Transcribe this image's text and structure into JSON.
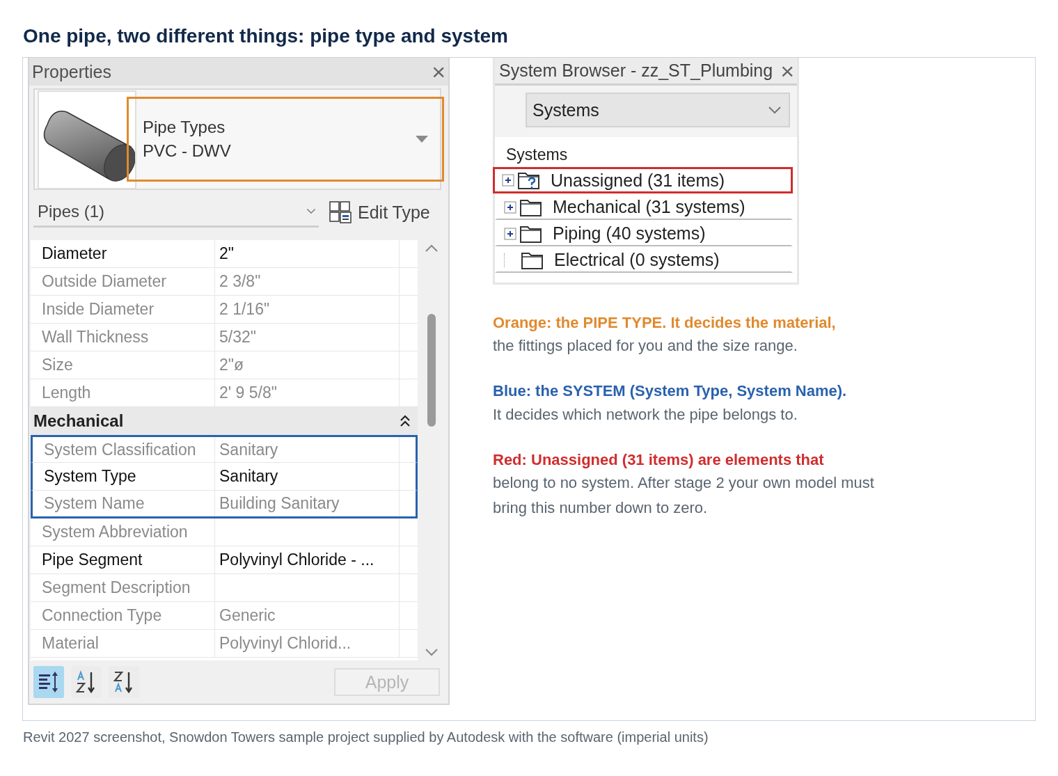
{
  "heading": "One pipe, two different things: pipe type and system",
  "properties": {
    "title": "Properties",
    "close": "×",
    "type_selector": {
      "family": "Pipe Types",
      "type": "PVC - DWV",
      "highlighted": true
    },
    "instance_filter": "Pipes (1)",
    "edit_type": "Edit Type",
    "rows": [
      {
        "kind": "param",
        "name": "Diameter",
        "value": "2\"",
        "editable": true,
        "highlighted": false
      },
      {
        "kind": "param",
        "name": "Outside Diameter",
        "value": "2 3/8\"",
        "editable": false,
        "highlighted": false
      },
      {
        "kind": "param",
        "name": "Inside Diameter",
        "value": "2 1/16\"",
        "editable": false,
        "highlighted": false
      },
      {
        "kind": "param",
        "name": "Wall Thickness",
        "value": "5/32\"",
        "editable": false,
        "highlighted": false
      },
      {
        "kind": "param",
        "name": "Size",
        "value": "2\"ø",
        "editable": false,
        "highlighted": false
      },
      {
        "kind": "param",
        "name": "Length",
        "value": "2'  9 5/8\"",
        "editable": false,
        "highlighted": false
      },
      {
        "kind": "group",
        "name": "Mechanical",
        "expanded": true
      },
      {
        "kind": "param",
        "name": "System Classification",
        "value": "Sanitary",
        "editable": false,
        "highlighted": true
      },
      {
        "kind": "param",
        "name": "System Type",
        "value": "Sanitary",
        "editable": true,
        "highlighted": true
      },
      {
        "kind": "param",
        "name": "System Name",
        "value": "Building Sanitary",
        "editable": false,
        "highlighted": true
      },
      {
        "kind": "param",
        "name": "System Abbreviation",
        "value": "",
        "editable": false,
        "highlighted": false
      },
      {
        "kind": "param",
        "name": "Pipe Segment",
        "value": "Polyvinyl Chloride - ...",
        "editable": true,
        "highlighted": false
      },
      {
        "kind": "param",
        "name": "Segment Description",
        "value": "",
        "editable": false,
        "highlighted": false
      },
      {
        "kind": "param",
        "name": "Connection Type",
        "value": "Generic",
        "editable": false,
        "highlighted": false
      },
      {
        "kind": "param",
        "name": "Material",
        "value": "Polyvinyl Chlorid...",
        "editable": false,
        "highlighted": false
      }
    ],
    "sort_buttons": [
      {
        "kind": "categorized",
        "selected": true
      },
      {
        "kind": "ascending",
        "selected": false
      },
      {
        "kind": "descending",
        "selected": false
      }
    ],
    "apply": {
      "label": "Apply",
      "disabled": true
    }
  },
  "system_browser": {
    "title": "System Browser - zz_ST_Plumbing",
    "close": "×",
    "view": "Systems",
    "column": "Systems",
    "items": [
      {
        "label": "Unassigned (31 items)",
        "kind": "unassigned",
        "expandable": true,
        "highlighted": true
      },
      {
        "label": "Mechanical (31 systems)",
        "kind": "folder",
        "expandable": true,
        "highlighted": false
      },
      {
        "label": "Piping (40 systems)",
        "kind": "folder",
        "expandable": true,
        "highlighted": false
      },
      {
        "label": "Electrical (0 systems)",
        "kind": "folder",
        "expandable": false,
        "highlighted": false
      }
    ]
  },
  "legend": [
    {
      "lead": "Orange: the PIPE TYPE. It decides the material,",
      "body": "the fittings placed for you and the size range.",
      "color": "#e08a2e"
    },
    {
      "lead": "Blue: the SYSTEM (System Type, System Name).",
      "body": "It decides which network the pipe belongs to.",
      "color": "#2a62ad"
    },
    {
      "lead": "Red: Unassigned (31 items) are elements that",
      "body": "belong to no system. After stage 2 your own model must bring this number down to zero.",
      "color": "#d02d2d"
    }
  ],
  "caption": "Revit 2027 screenshot, Snowdon Towers sample project supplied by Autodesk with the software (imperial units)"
}
